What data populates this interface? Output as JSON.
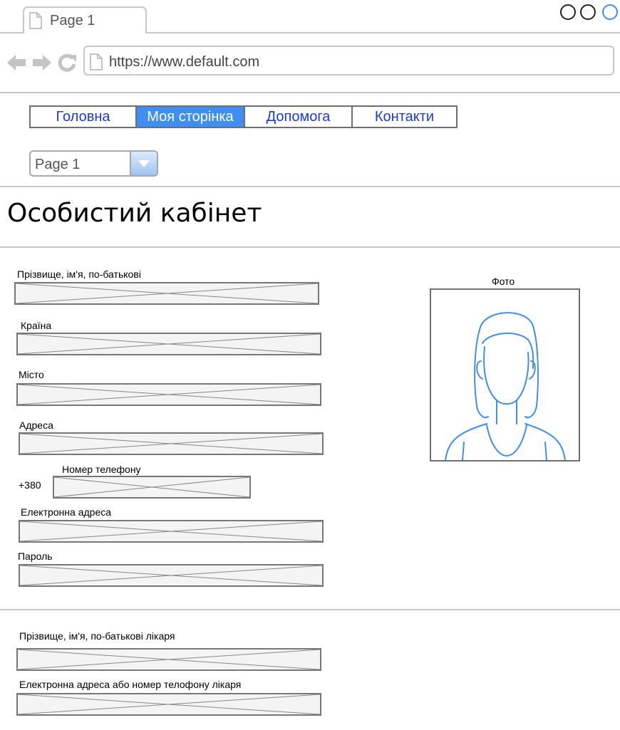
{
  "browser": {
    "tab_title": "Page 1",
    "url": "https://www.default.com"
  },
  "nav": {
    "items": [
      {
        "label": "Головна"
      },
      {
        "label": "Моя сторінка",
        "active": true
      },
      {
        "label": "Допомога"
      },
      {
        "label": "Контакти"
      }
    ],
    "active_color": "#3f8ef2",
    "link_color": "#1a38e6"
  },
  "page_select": {
    "value": "Page 1"
  },
  "page": {
    "title": "Особистий кабінет"
  },
  "form": {
    "full_name_label": "Прізвище, ім'я, по-батькові",
    "country_label": "Країна",
    "city_label": "Місто",
    "address_label": "Адреса",
    "phone_label": "Номер телефону",
    "phone_prefix": "+380",
    "email_label": "Електронна адреса",
    "password_label": "Пароль"
  },
  "photo": {
    "label": "Фото",
    "icon": "person-silhouette-icon"
  },
  "doctor": {
    "name_label": "Прізвище, ім'я, по-батькові лікаря",
    "contact_label": "Електронна адреса або номер телофону лікаря"
  }
}
